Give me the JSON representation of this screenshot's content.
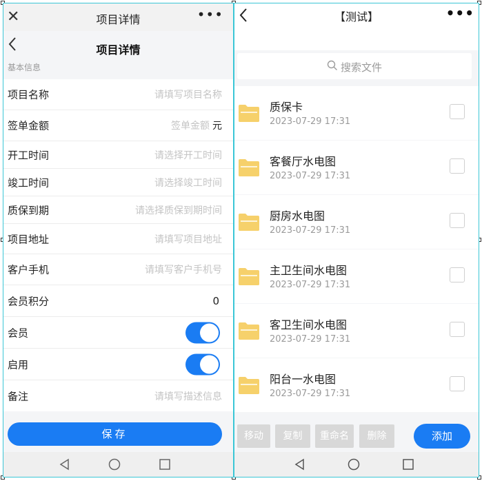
{
  "left": {
    "topbar": {
      "close": "✕",
      "title": "项目详情",
      "more": "•••"
    },
    "header": {
      "title": "项目详情",
      "section": "基本信息"
    },
    "form": {
      "project_name": {
        "label": "项目名称",
        "placeholder": "请填写项目名称"
      },
      "contract_amount": {
        "label": "签单金额",
        "placeholder": "签单金额",
        "unit": "元"
      },
      "start_time": {
        "label": "开工时间",
        "placeholder": "请选择开工时间"
      },
      "finish_time": {
        "label": "竣工时间",
        "placeholder": "请选择竣工时间"
      },
      "warranty_due": {
        "label": "质保到期",
        "placeholder": "请选择质保到期时间"
      },
      "project_address": {
        "label": "项目地址",
        "placeholder": "请填写项目地址"
      },
      "customer_phone": {
        "label": "客户手机",
        "placeholder": "请填写客户手机号"
      },
      "member_points": {
        "label": "会员积分",
        "value": "0"
      },
      "member": {
        "label": "会员",
        "on": true
      },
      "enabled": {
        "label": "启用",
        "on": true
      },
      "remark": {
        "label": "备注",
        "placeholder": "请填写描述信息"
      }
    },
    "save_label": "保存"
  },
  "right": {
    "topbar": {
      "title": "【测试】",
      "more": "•••"
    },
    "search": {
      "placeholder": "搜索文件"
    },
    "files": [
      {
        "name": "质保卡",
        "time": "2023-07-29 17:31"
      },
      {
        "name": "客餐厅水电图",
        "time": "2023-07-29 17:31"
      },
      {
        "name": "厨房水电图",
        "time": "2023-07-29 17:31"
      },
      {
        "name": "主卫生间水电图",
        "time": "2023-07-29 17:31"
      },
      {
        "name": "客卫生间水电图",
        "time": "2023-07-29 17:31"
      },
      {
        "name": "阳台一水电图",
        "time": "2023-07-29 17:31"
      }
    ],
    "actions": {
      "move": "移动",
      "copy": "复制",
      "rename": "重命名",
      "delete": "删除",
      "add": "添加"
    }
  },
  "colors": {
    "accent": "#1a7cf3",
    "folder": "#f6d06b",
    "disabled": "#d8d8d8",
    "frame": "#39c6d6"
  }
}
